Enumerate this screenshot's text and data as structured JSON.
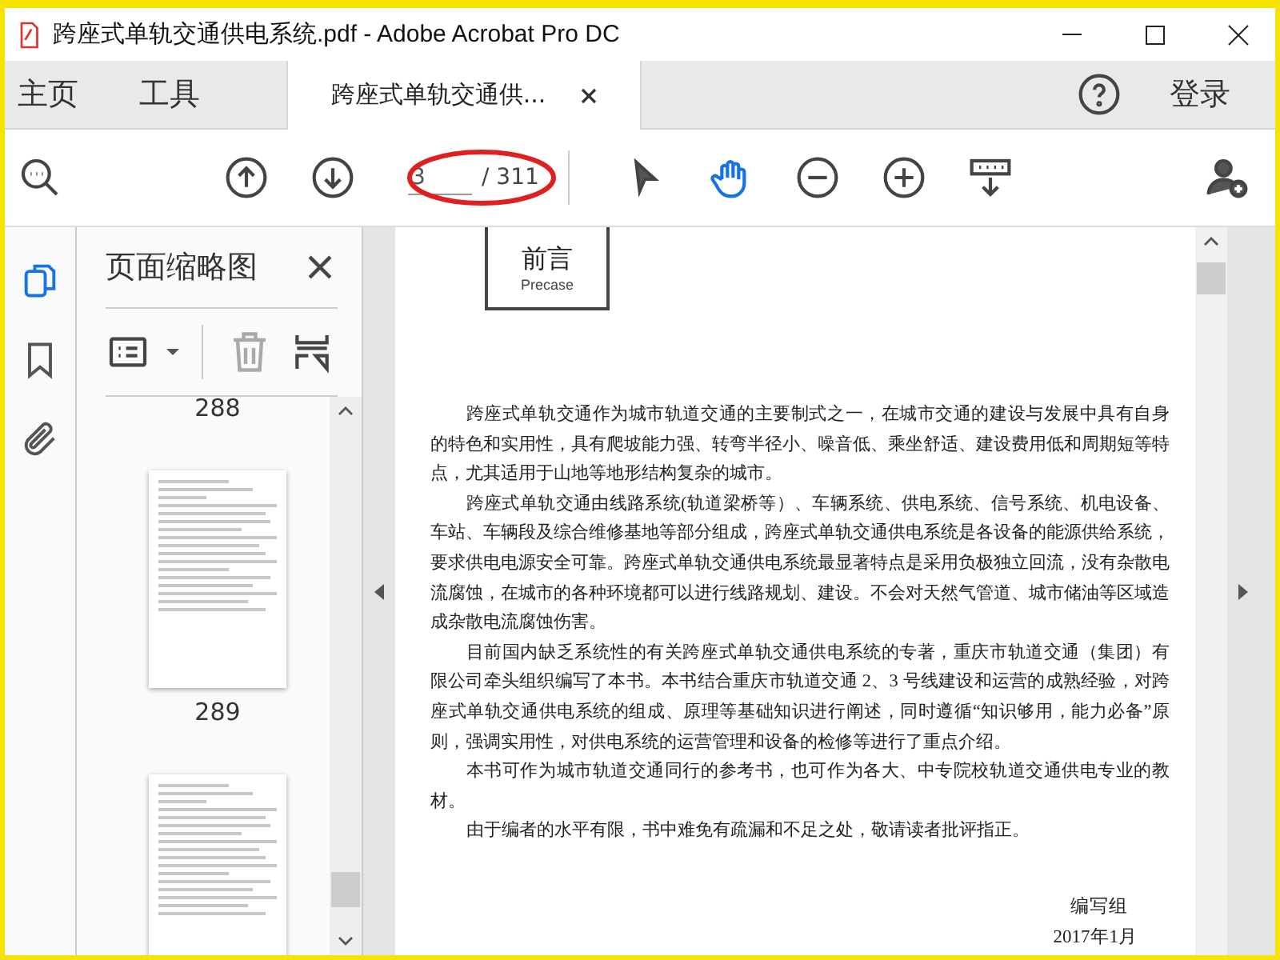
{
  "window": {
    "title": "跨座式单轨交通供电系统.pdf - Adobe Acrobat Pro DC"
  },
  "nav_tabs": [
    {
      "label": "主页",
      "selected": false
    },
    {
      "label": "工具",
      "selected": false
    }
  ],
  "document_tabs": [
    {
      "label": "跨座式单轨交通供...",
      "selected": true
    }
  ],
  "sign_in": "登录",
  "toolbar": {
    "page_field": {
      "value": "3"
    },
    "page_total": "/ 311",
    "hand_tool_selected": true
  },
  "side_rail": [
    {
      "kind": "pages",
      "selected": true
    },
    {
      "kind": "bookmarks",
      "selected": false
    },
    {
      "kind": "attachments",
      "selected": false
    }
  ],
  "thumbnail_panel": {
    "title": "页面缩略图",
    "pages": [
      {
        "label": "288"
      },
      {
        "label": "289"
      }
    ]
  },
  "document": {
    "heading": "前言",
    "subheading": "Precase",
    "paragraphs": [
      "跨座式单轨交通作为城市轨道交通的主要制式之一，在城市交通的建设与发展中具有自身的特色和实用性，具有爬坡能力强、转弯半径小、噪音低、乘坐舒适、建设费用低和周期短等特点，尤其适用于山地等地形结构复杂的城市。",
      "跨座式单轨交通由线路系统(轨道梁桥等）、车辆系统、供电系统、信号系统、机电设备、车站、车辆段及综合维修基地等部分组成，跨座式单轨交通供电系统是各设备的能源供给系统，要求供电电源安全可靠。跨座式单轨交通供电系统最显著特点是采用负极独立回流，没有杂散电流腐蚀，在城市的各种环境都可以进行线路规划、建设。不会对天然气管道、城市储油等区域造成杂散电流腐蚀伤害。",
      "目前国内缺乏系统性的有关跨座式单轨交通供电系统的专著，重庆市轨道交通（集团）有限公司牵头组织编写了本书。本书结合重庆市轨道交通 2、3 号线建设和运营的成熟经验，对跨座式单轨交通供电系统的组成、原理等基础知识进行阐述，同时遵循“知识够用，能力必备”原则，强调实用性，对供电系统的运营管理和设备的检修等进行了重点介绍。",
      "本书可作为城市轨道交通同行的参考书，也可作为各大、中专院校轨道交通供电专业的教材。",
      "由于编者的水平有限，书中难免有疏漏和不足之处，敬请读者批评指正。"
    ],
    "signature": "编写组",
    "date": "2017年1月"
  }
}
